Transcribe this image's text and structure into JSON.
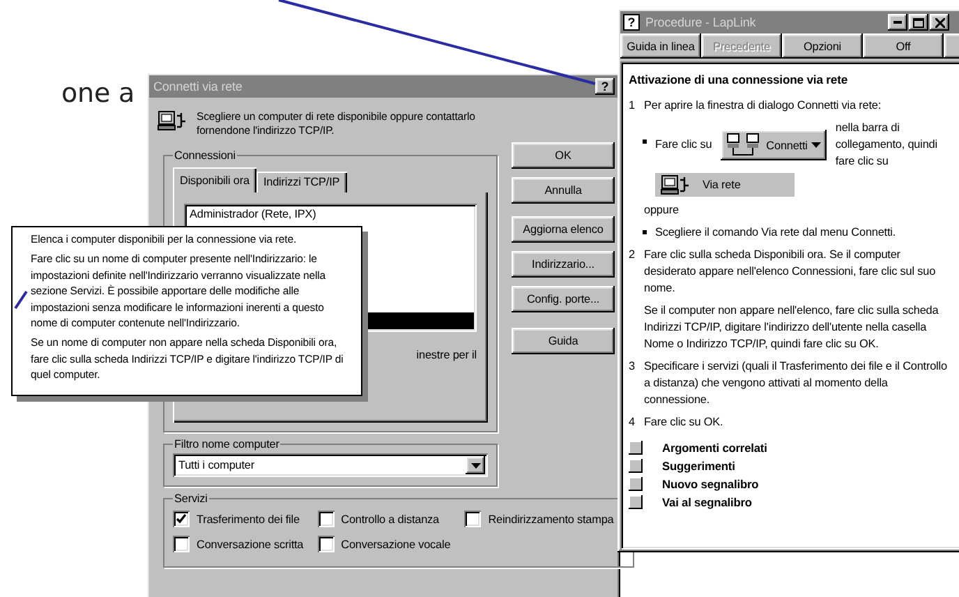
{
  "page_text": "one a",
  "dialog": {
    "title": "Connetti via rete",
    "help_button": "?",
    "intro": "Scegliere un computer di rete disponibile oppure contattarlo fornendone l'indirizzo TCP/IP.",
    "connections": {
      "label": "Connessioni",
      "tabs": [
        {
          "label": "Disponibili ora",
          "selected": true
        },
        {
          "label": "Indirizzi TCP/IP",
          "selected": false
        }
      ],
      "list_items": [
        {
          "label": "Administrador (Rete, IPX)",
          "selected": false
        },
        {
          "selected": true
        }
      ],
      "note": "inestre per il"
    },
    "buttons": [
      "OK",
      "Annulla",
      "Aggiorna elenco",
      "Indirizzario...",
      "Config. porte...",
      "Guida"
    ],
    "filter": {
      "label": "Filtro nome computer",
      "value": "Tutti i computer"
    },
    "services": {
      "label": "Servizi",
      "options": [
        {
          "label": "Trasferimento dei file",
          "checked": true
        },
        {
          "label": "Controllo a distanza",
          "checked": false
        },
        {
          "label": "Reindirizzamento stampa",
          "checked": false
        },
        {
          "label": "Conversazione scritta",
          "checked": false
        },
        {
          "label": "Conversazione vocale",
          "checked": false
        }
      ]
    }
  },
  "tooltip": {
    "paragraphs": [
      "Elenca i computer disponibili per la connessione via rete.",
      "Fare clic su un nome di computer presente nell'Indirizzario: le impostazioni definite nell'Indirizzario verranno visualizzate nella sezione Servizi. È possibile apportare delle modifiche alle impostazioni senza modificare le informazioni inerenti a questo nome di computer contenute nell'Indirizzario.",
      "Se un nome di computer non appare nella scheda Disponibili ora, fare clic sulla scheda Indirizzi TCP/IP e digitare l'indirizzo TCP/IP di quel computer."
    ]
  },
  "help_window": {
    "title": "Procedure - LapLink",
    "icon_text": "?",
    "buttons": [
      {
        "label": "Guida in linea",
        "disabled": false
      },
      {
        "label": "Precedente",
        "disabled": true
      },
      {
        "label": "Opzioni",
        "disabled": false
      },
      {
        "label": "Off",
        "disabled": false
      }
    ],
    "heading": "Attivazione di una connessione via rete",
    "content": [
      {
        "kind": "step",
        "number": "1",
        "text": "Per aprire la finestra di dialogo Connetti via rete:"
      },
      {
        "kind": "toolbar_bullet",
        "before": "Fare clic su",
        "button": "Connetti",
        "after": "nella barra di collegamento, quindi fare clic su",
        "menu_item": "Via rete"
      },
      {
        "kind": "or",
        "text": "oppure"
      },
      {
        "kind": "bullet",
        "text": "Scegliere il comando Via rete dal menu Connetti."
      },
      {
        "kind": "step",
        "number": "2",
        "text": "Fare clic sulla scheda Disponibili ora. Se il computer desiderato appare nell'elenco Connessioni, fare clic sul suo nome."
      },
      {
        "kind": "para",
        "text": "Se il computer non appare nell'elenco, fare clic sulla scheda Indirizzi TCP/IP, digitare l'indirizzo dell'utente nella casella Nome o Indirizzo TCP/IP, quindi fare clic su OK."
      },
      {
        "kind": "step",
        "number": "3",
        "text": "Specificare i servizi (quali il Trasferimento dei file e il Controllo a distanza) che vengono attivati al momento della connessione."
      },
      {
        "kind": "step",
        "number": "4",
        "text": "Fare clic su OK."
      }
    ],
    "links": [
      "Argomenti correlati",
      "Suggerimenti",
      "Nuovo segnalibro",
      "Vai al segnalibro"
    ]
  }
}
